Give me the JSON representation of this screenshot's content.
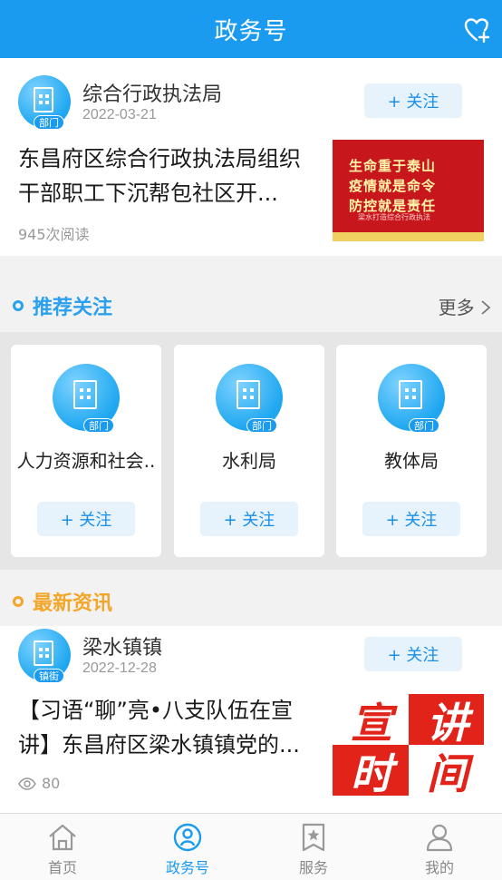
{
  "header": {
    "title": "政务号",
    "follow_icon": "heart-plus-icon"
  },
  "top_card": {
    "org_name": "综合行政执法局",
    "org_tag": "部门",
    "date": "2022-03-21",
    "follow_label": "+ 关注",
    "article_title": "东昌府区综合行政执法局组织干部职工下沉帮包社区开...",
    "read_count": "945次阅读",
    "thumbnail_lines": [
      "生命重于泰山",
      "疫情就是命令",
      "防控就是责任"
    ],
    "thumbnail_small": "梁水打造综合行政执法"
  },
  "recommend": {
    "title": "推荐关注",
    "more": "更多",
    "items": [
      {
        "name": "人力资源和社会..",
        "tag": "部门",
        "follow": "+ 关注"
      },
      {
        "name": "水利局",
        "tag": "部门",
        "follow": "+ 关注"
      },
      {
        "name": "教体局",
        "tag": "部门",
        "follow": "+ 关注"
      }
    ]
  },
  "news": {
    "title": "最新资讯",
    "org_name": "梁水镇镇",
    "org_tag": "镇街",
    "date": "2022-12-28",
    "follow_label": "+ 关注",
    "article_title": "【习语“聊”亮•八支队伍在宣讲】东昌府区梁水镇镇党的...",
    "views": "80",
    "thumbnail_chars": [
      "宣",
      "讲",
      "时",
      "间"
    ]
  },
  "tabbar": [
    {
      "label": "首页",
      "icon": "home-icon",
      "active": false
    },
    {
      "label": "政务号",
      "icon": "gov-account-icon",
      "active": true
    },
    {
      "label": "服务",
      "icon": "service-star-icon",
      "active": false
    },
    {
      "label": "我的",
      "icon": "profile-icon",
      "active": false
    }
  ],
  "colors": {
    "brand": "#1a9bf0",
    "recommend_accent": "#2aa0ee",
    "news_accent": "#f3a72a"
  }
}
